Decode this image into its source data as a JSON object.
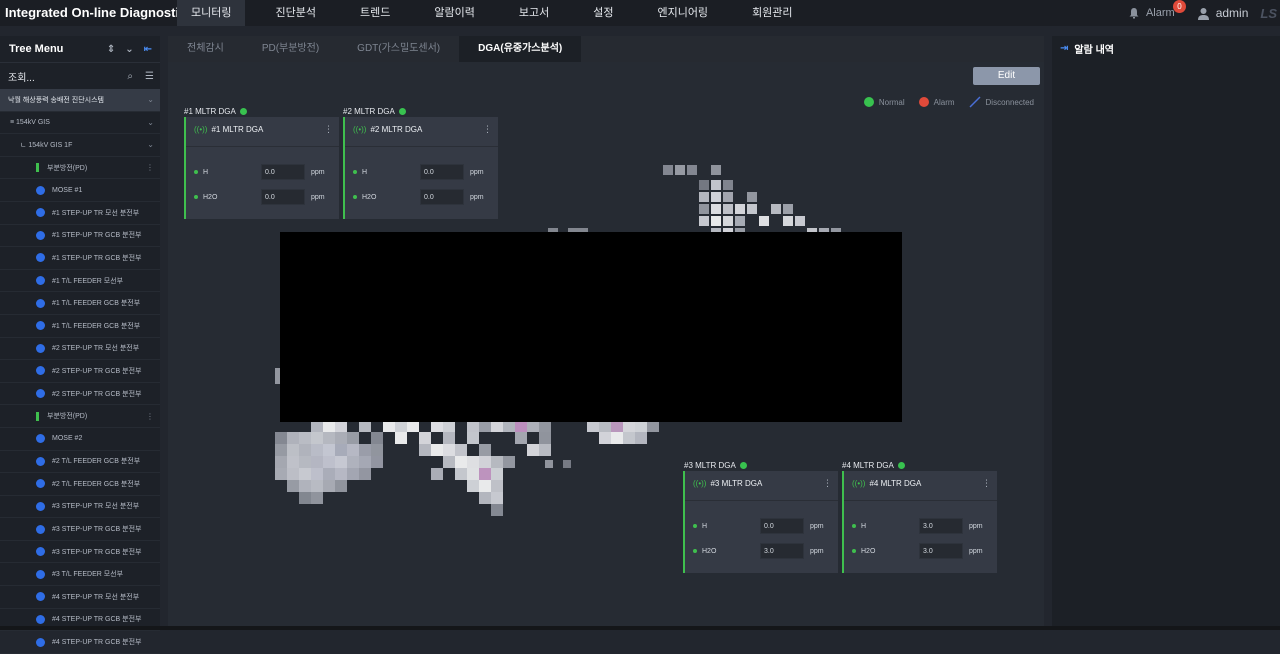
{
  "app": {
    "title": "Integrated On-line Diagnostic"
  },
  "nav": {
    "items": [
      "모니터링",
      "진단분석",
      "트렌드",
      "알람이력",
      "보고서",
      "설정",
      "엔지니어링",
      "회원관리"
    ],
    "active_index": 0
  },
  "header": {
    "alarm_label": "Alarm",
    "alarm_count": "0",
    "user": "admin",
    "logo": "LS"
  },
  "sidebar": {
    "title": "Tree Menu",
    "search_label": "조회...",
    "rows": [
      {
        "kind": "root",
        "label": "낙월 해상풍력 송배전 진단시스템"
      },
      {
        "kind": "level1",
        "label": "≡ 154kV GIS"
      },
      {
        "kind": "level2",
        "label": "ㄴ 154kV GIS 1F"
      },
      {
        "kind": "group",
        "label": "부분방전(PD)"
      },
      {
        "kind": "item",
        "label": "MOSE #1"
      },
      {
        "kind": "item",
        "label": "#1 STEP-UP TR 모선 분전부"
      },
      {
        "kind": "item",
        "label": "#1 STEP-UP TR GCB 분전부"
      },
      {
        "kind": "item",
        "label": "#1 STEP-UP TR GCB 분전부"
      },
      {
        "kind": "item",
        "label": "#1 T/L FEEDER 모선부"
      },
      {
        "kind": "item",
        "label": "#1 T/L FEEDER GCB 분전부"
      },
      {
        "kind": "item",
        "label": "#1 T/L FEEDER GCB 분전부"
      },
      {
        "kind": "item",
        "label": "#2 STEP-UP TR 모선 분전부"
      },
      {
        "kind": "item",
        "label": "#2 STEP-UP TR GCB 분전부"
      },
      {
        "kind": "item",
        "label": "#2 STEP-UP TR GCB 분전부"
      },
      {
        "kind": "group",
        "label": "부분방전(PD)"
      },
      {
        "kind": "item",
        "label": "MOSE #2"
      },
      {
        "kind": "item",
        "label": "#2 T/L FEEDER GCB 분전부"
      },
      {
        "kind": "item",
        "label": "#2 T/L FEEDER GCB 분전부"
      },
      {
        "kind": "item",
        "label": "#3 STEP-UP TR 모선 분전부"
      },
      {
        "kind": "item",
        "label": "#3 STEP-UP TR GCB 분전부"
      },
      {
        "kind": "item",
        "label": "#3 STEP-UP TR GCB 분전부"
      },
      {
        "kind": "item",
        "label": "#3 T/L FEEDER 모선부"
      },
      {
        "kind": "item",
        "label": "#4 STEP-UP TR 모선 분전부"
      },
      {
        "kind": "item",
        "label": "#4 STEP-UP TR GCB 분전부"
      },
      {
        "kind": "item",
        "label": "#4 STEP-UP TR GCB 분전부"
      }
    ]
  },
  "tabs": [
    "전체감시",
    "PD(부분방전)",
    "GDT(가스밀도센서)",
    "DGA(유중가스분석)"
  ],
  "active_tab": 3,
  "toolbar": {
    "edit_label": "Edit"
  },
  "legend": {
    "normal": "Normal",
    "alarm": "Alarm",
    "disconnected": "Disconnected"
  },
  "cards": [
    {
      "label": "#1 MLTR DGA",
      "title": "#1 MLTR DGA",
      "measurements": [
        {
          "name": "H",
          "value": "0.0",
          "unit": "ppm"
        },
        {
          "name": "H2O",
          "value": "0.0",
          "unit": "ppm"
        }
      ]
    },
    {
      "label": "#2 MLTR DGA",
      "title": "#2 MLTR DGA",
      "measurements": [
        {
          "name": "H",
          "value": "0.0",
          "unit": "ppm"
        },
        {
          "name": "H2O",
          "value": "0.0",
          "unit": "ppm"
        }
      ]
    },
    {
      "label": "#3 MLTR DGA",
      "title": "#3 MLTR DGA",
      "measurements": [
        {
          "name": "H",
          "value": "0.0",
          "unit": "ppm"
        },
        {
          "name": "H2O",
          "value": "3.0",
          "unit": "ppm"
        }
      ]
    },
    {
      "label": "#4 MLTR DGA",
      "title": "#4 MLTR DGA",
      "measurements": [
        {
          "name": "H",
          "value": "3.0",
          "unit": "ppm"
        },
        {
          "name": "H2O",
          "value": "3.0",
          "unit": "ppm"
        }
      ]
    }
  ],
  "alarm_panel": {
    "title": "알람 내역"
  },
  "colors": {
    "normal": "#38c24f",
    "alarm": "#e04a3a",
    "accent": "#2f6de6",
    "background": "#22262e"
  }
}
